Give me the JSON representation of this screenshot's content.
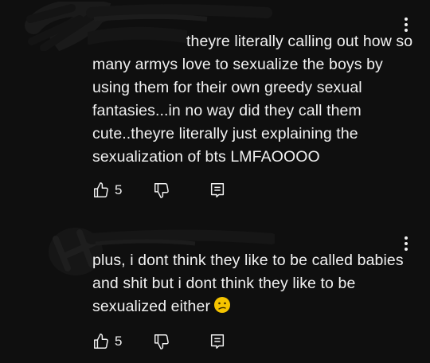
{
  "comments": [
    {
      "author": "",
      "reply_mention": "",
      "text": "theyre literally calling out how so many armys love to sexualize the boys by using them for their own greedy sexual fantasies...in no way did they call them cute..theyre literally just explaining the sexualization of bts LMFAOOOO",
      "like_count": "5",
      "icons": {
        "like": "thumbs-up-icon",
        "dislike": "thumbs-down-icon",
        "reply": "reply-icon",
        "menu": "more-vert-icon"
      }
    },
    {
      "author": "",
      "text": "plus, i dont think they like to be called babies and shit but i dont think they like to be sexualized either",
      "emoji": "confused-face-emoji",
      "like_count": "5",
      "icons": {
        "like": "thumbs-up-icon",
        "dislike": "thumbs-down-icon",
        "reply": "reply-icon",
        "menu": "more-vert-icon"
      }
    }
  ],
  "colors": {
    "background": "#0f0f0f",
    "text": "#f1f1f1",
    "mention": "#3ea6ff",
    "emoji": "#f5c400"
  }
}
